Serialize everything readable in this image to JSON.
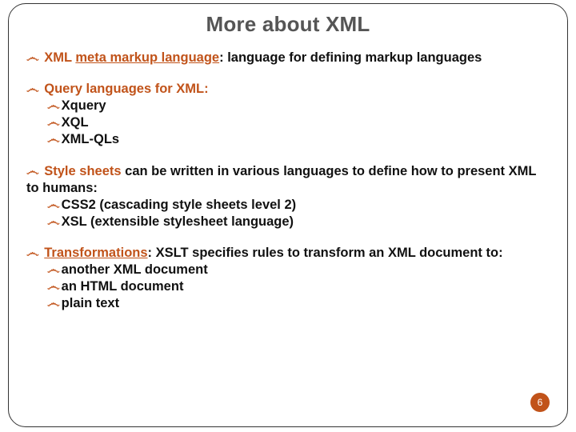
{
  "title": "More about XML",
  "attribution": "",
  "page_number": "6",
  "bullet_glyph": "෴",
  "groups": [
    {
      "key": "meta",
      "lead_keyword": "XML",
      "lead_rest_underlined": "meta markup language",
      "lead_tail": ": language for defining markup languages",
      "subs": []
    },
    {
      "key": "query",
      "lead_keyword": "Query languages for XML:",
      "lead_rest_underlined": "",
      "lead_tail": "",
      "subs": [
        "Xquery",
        "XQL",
        "XML-QLs"
      ]
    },
    {
      "key": "style",
      "lead_keyword": "Style sheets",
      "lead_rest_underlined": "",
      "lead_tail": " can be written in various languages to define how to present XML to humans:",
      "subs": [
        "CSS2 (cascading style sheets level 2)",
        "XSL (extensible stylesheet language)"
      ]
    },
    {
      "key": "transform",
      "lead_keyword": "",
      "lead_rest_underlined": "Transformations",
      "lead_tail": ": XSLT specifies rules to transform an XML document to:",
      "subs": [
        "another XML document",
        "an HTML document",
        "plain text"
      ]
    }
  ]
}
